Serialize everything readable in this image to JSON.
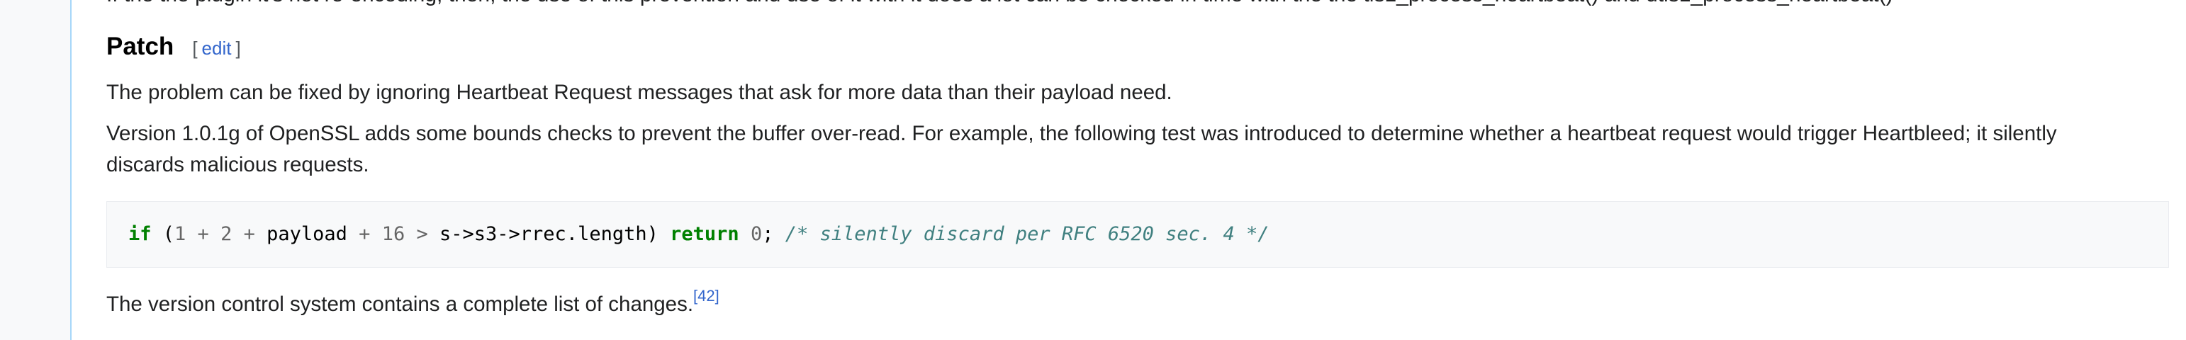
{
  "article": {
    "cut_line": "If the the plugin it's not re-encoding, then, the use of this prevention and use of it with it does a lot can be checked in time with the the tls1_process_heartbeat() and dtls1_process_heartbeat()",
    "section": {
      "title": "Patch",
      "edit_open": "[",
      "edit_label": "edit",
      "edit_close": "]"
    },
    "para1": "The problem can be fixed by ignoring Heartbeat Request messages that ask for more data than their payload need.",
    "para2": "Version 1.0.1g of OpenSSL adds some bounds checks to prevent the buffer over-read. For example, the following test was introduced to determine whether a heartbeat request would trigger Heartbleed; it silently discards malicious requests.",
    "code": {
      "kw_if": "if",
      "p_open": " (",
      "n1": "1",
      "plus1": " + ",
      "n2": "2",
      "plus2": " + ",
      "id_payload": "payload",
      "plus3": " + ",
      "n16": "16",
      "gt": " > ",
      "expr": "s->s3->rrec.length)",
      "space1": " ",
      "kw_return": "return",
      "space2": " ",
      "n0": "0",
      "semi": ";",
      "space3": " ",
      "comment": "/* silently discard per RFC 6520 sec. 4 */"
    },
    "para3": "The version control system contains a complete list of changes.",
    "citation": "[42]"
  }
}
